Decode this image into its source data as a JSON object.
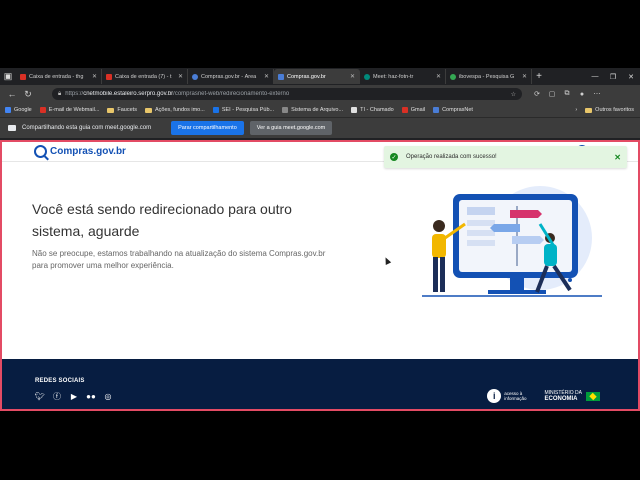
{
  "tabs": [
    {
      "title": "Caixa de entrada - thg",
      "color": "#d93025",
      "active": false
    },
    {
      "title": "Caixa de entrada (7) - t",
      "color": "#d93025",
      "active": false
    },
    {
      "title": "Compras.gov.br - Área",
      "color": "#4a7dd6",
      "active": false
    },
    {
      "title": "Compras.gov.br",
      "color": "#4a7dd6",
      "active": true
    },
    {
      "title": "Meet: haz-fotn-tr",
      "color": "#00897b",
      "active": false
    },
    {
      "title": "ibovespa - Pesquisa G",
      "color": "#34a853",
      "active": false
    }
  ],
  "address": {
    "prefix": "https://",
    "host": "cnetmobile.estaleiro.serpro.gov.br",
    "path": "/comprasnet-web/redirecionamento-externo"
  },
  "bookmarks": [
    {
      "label": "Google",
      "type": "site",
      "color": "#4285f4"
    },
    {
      "label": "E-mail de Webmail...",
      "type": "site",
      "color": "#d93025"
    },
    {
      "label": "Faucets",
      "type": "folder"
    },
    {
      "label": "Ações, fundos imo...",
      "type": "folder"
    },
    {
      "label": "SEI - Pesquisa Púb...",
      "type": "site",
      "color": "#1a73e8"
    },
    {
      "label": "Sistema de Arquivo...",
      "type": "site",
      "color": "#888888"
    },
    {
      "label": "TI - Chamado",
      "type": "site",
      "color": "#e0e0e0"
    },
    {
      "label": "Gmail",
      "type": "site",
      "color": "#d93025"
    },
    {
      "label": "ComprasNet",
      "type": "site",
      "color": "#4a7dd6"
    }
  ],
  "bookmarks_other": "Outros favoritos",
  "share": {
    "text": "Compartilhando esta guia com meet.google.com",
    "stop_label": "Parar compartilhamento",
    "go_label": "Ver a guia meet.google.com"
  },
  "page": {
    "logo_text": "Compras.gov.br",
    "toast": "Operação realizada com sucesso!",
    "headline_1": "Você está sendo redirecionado para outro",
    "headline_2": "sistema, aguarde",
    "subtext_1": "Não se preocupe, estamos trabalhando na atualização do sistema Compras.gov.br",
    "subtext_2": "para promover uma melhor experiência."
  },
  "footer": {
    "title": "REDES SOCIAIS",
    "social": [
      "twitter-icon",
      "facebook-icon",
      "youtube-icon",
      "flickr-icon",
      "instagram-icon"
    ],
    "access_info_1": "acesso à",
    "access_info_2": "informação",
    "ministry_1": "MINISTÉRIO DA",
    "ministry_2": "ECONOMIA"
  },
  "colors": {
    "gov_blue": "#1351b4",
    "footer_bg": "#071d41",
    "toast_bg": "#e3f5e1",
    "success": "#168821",
    "share_blue": "#1a73e8",
    "page_border": "#e34b64"
  }
}
